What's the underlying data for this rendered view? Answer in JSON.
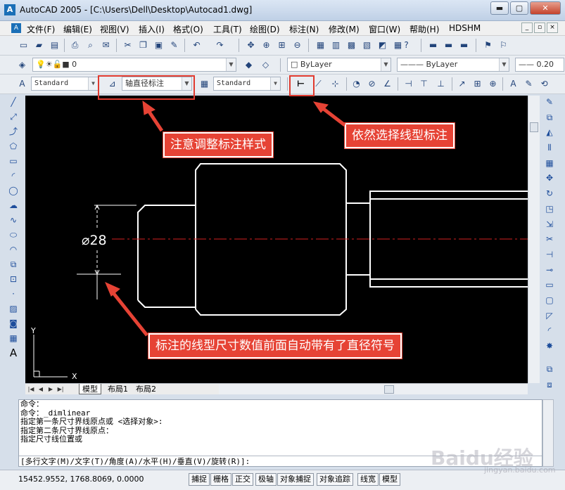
{
  "window": {
    "title": "AutoCAD 2005 - [C:\\Users\\Dell\\Desktop\\Autocad1.dwg]",
    "minimize": "▬",
    "maximize": "▢",
    "close": "✕"
  },
  "menu": [
    "文件(F)",
    "编辑(E)",
    "视图(V)",
    "插入(I)",
    "格式(O)",
    "工具(T)",
    "绘图(D)",
    "标注(N)",
    "修改(M)",
    "窗口(W)",
    "帮助(H)",
    "HDSHM"
  ],
  "layer_bar": {
    "layer_value": "0",
    "color_value": "ByLayer",
    "linetype_value": "ByLayer",
    "lineweight_value": "0.20"
  },
  "styles_bar": {
    "text_style": "Standard",
    "dim_style": "轴直径标注",
    "table_style": "Standard"
  },
  "drawing": {
    "dimension_text": "⌀28",
    "ucs_y": "Y",
    "ucs_x": "X"
  },
  "layout_tabs": [
    "模型",
    "布局1",
    "布局2"
  ],
  "command_history": [
    "命令：",
    "命令：_dimlinear",
    "指定第一条尺寸界线原点或 <选择对象>:",
    "指定第二条尺寸界线原点：",
    "指定尺寸线位置或"
  ],
  "command_prompt": "[多行文字(M)/文字(T)/角度(A)/水平(H)/垂直(V)/旋转(R)]:",
  "status": {
    "coords": "15452.9552, 1768.8069, 0.0000",
    "toggles": [
      "捕捉",
      "栅格",
      "正交",
      "极轴",
      "对象捕捉",
      "对象追踪",
      "线宽",
      "模型"
    ]
  },
  "annotations": {
    "dimstyle_note": "注意调整标注样式",
    "linear_note": "依然选择线型标注",
    "result_note": "标注的线型尺寸数值前面自动带有了直径符号"
  },
  "watermark": {
    "text": "Baidu经验",
    "sub": "jingyan.baidu.com"
  },
  "colors": {
    "canvas_bg": "#000000",
    "geometry": "#ffffff",
    "center_line": "#d42020",
    "callout_bg": "#e64335"
  }
}
